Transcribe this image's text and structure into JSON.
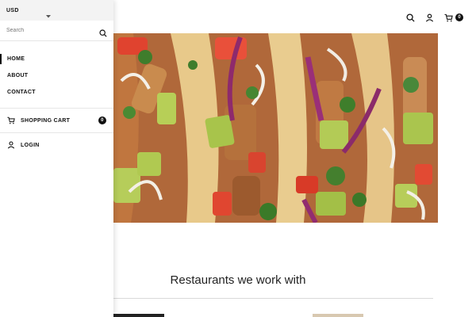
{
  "drawer": {
    "currency": "USD",
    "search_placeholder": "Search",
    "nav": [
      {
        "label": "HOME"
      },
      {
        "label": "ABOUT"
      },
      {
        "label": "CONTACT"
      }
    ],
    "cart_label": "SHOPPING CART",
    "cart_count": "0",
    "login_label": "LOGIN"
  },
  "header": {
    "cart_count": "0"
  },
  "main": {
    "section_title": "Restaurants we work with"
  }
}
